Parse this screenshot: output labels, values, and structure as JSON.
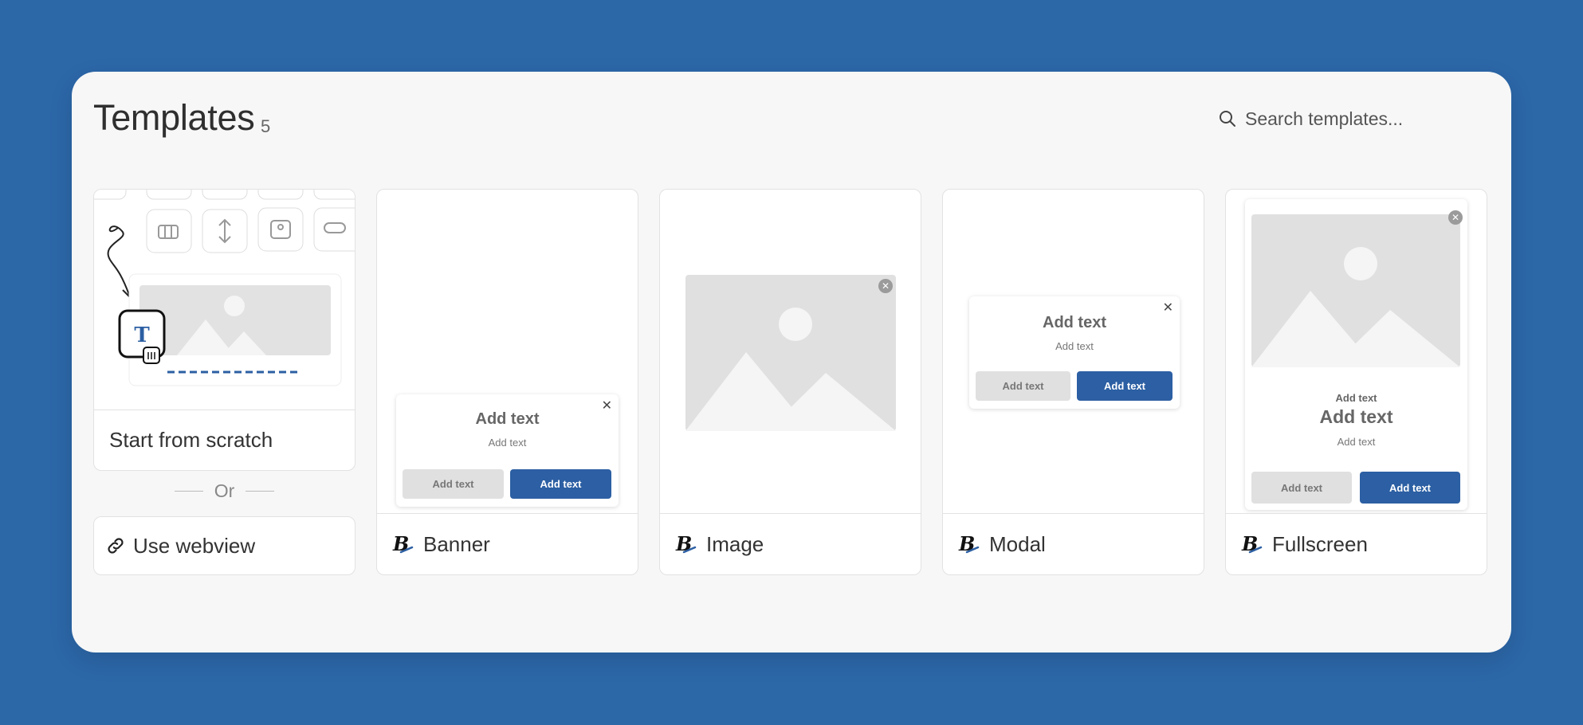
{
  "header": {
    "title": "Templates",
    "count": "5"
  },
  "search": {
    "placeholder": "Search templates..."
  },
  "scratch": {
    "label": "Start from scratch"
  },
  "separator": {
    "label": "Or"
  },
  "webview": {
    "label": "Use webview"
  },
  "templates": [
    {
      "name": "Banner"
    },
    {
      "name": "Image"
    },
    {
      "name": "Modal"
    },
    {
      "name": "Fullscreen"
    }
  ],
  "placeholder_text": "Add text",
  "colors": {
    "background": "#2c67a8",
    "panel": "#f7f7f7",
    "accent": "#2c5fa3"
  }
}
